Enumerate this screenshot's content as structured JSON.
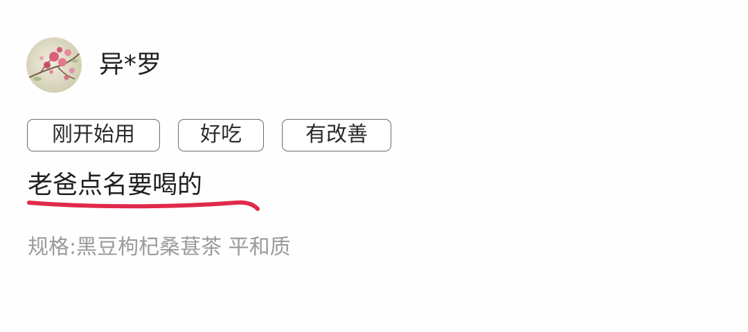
{
  "user": {
    "name": "异*罗",
    "avatar": "pink-blossom-avatar"
  },
  "tags": [
    "刚开始用",
    "好吃",
    "有改善"
  ],
  "review": {
    "text": "老爸点名要喝的",
    "highlight_color": "#e0294a"
  },
  "spec": {
    "text": "规格:黑豆枸杞桑葚茶 平和质"
  }
}
